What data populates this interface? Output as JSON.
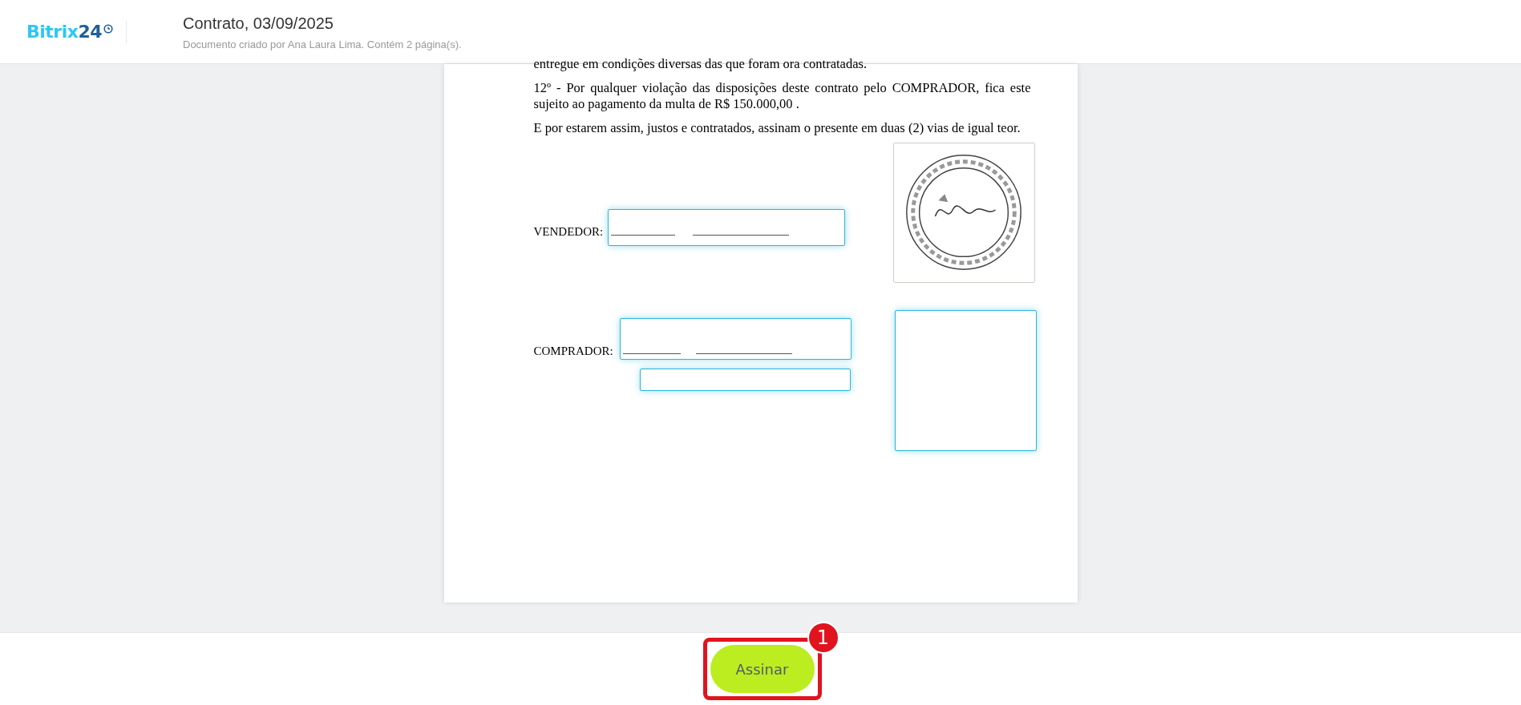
{
  "header": {
    "logo": {
      "word": "Bitrix",
      "number": "24"
    },
    "title": "Contrato, 03/09/2025",
    "subtitle": "Documento criado por Ana Laura Lima. Contém 2 página(s)."
  },
  "document": {
    "paragraphs": [
      "entregue em condições diversas das que foram ora contratadas.",
      "12º - Por qualquer violação das disposições deste contrato pelo COMPRADOR, fica este sujeito ao pagamento da multa de R$ 150.000,00 .",
      "E por estarem assim, justos e contratados, assinam o presente em duas (2) vias de igual teor."
    ],
    "signatures": [
      {
        "label": "VENDEDOR:"
      },
      {
        "label": "COMPRADOR:"
      }
    ]
  },
  "footer": {
    "button": "Assinar",
    "annotation": "1"
  }
}
